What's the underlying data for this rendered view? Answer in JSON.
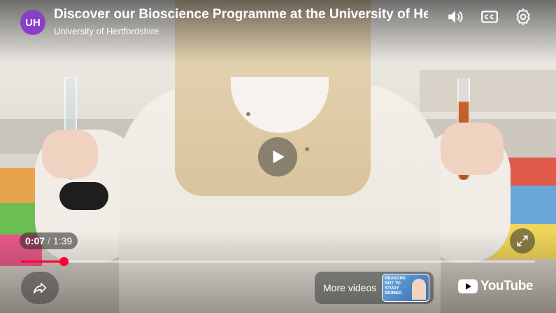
{
  "video": {
    "title": "Discover our Bioscience Programme at the University of Hertfordshire",
    "channel_name": "University of Hertfordshire",
    "channel_avatar_text": "UH",
    "progress_fraction": 0.083
  },
  "time": {
    "current": "0:07",
    "separator": "/",
    "duration": "1:39"
  },
  "controls": {
    "volume_icon": "volume-icon",
    "cc_icon": "closed-captions-icon",
    "settings_icon": "gear-icon",
    "play_icon": "play-icon",
    "fullscreen_icon": "fullscreen-icon",
    "share_icon": "share-icon"
  },
  "more_videos": {
    "label": "More videos",
    "thumbnail_text": "REASONS NOT TO STUDY BIOMED"
  },
  "branding": {
    "youtube_word": "YouTube"
  },
  "colors": {
    "accent": "#ff0033",
    "avatar": "#8a3fc8"
  }
}
